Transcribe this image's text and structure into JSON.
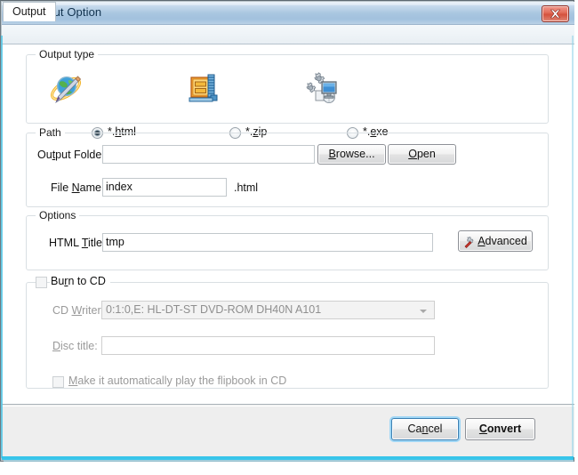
{
  "window": {
    "title": "Output Option",
    "app_icon": "question-mark-icon",
    "close_icon": "close-icon",
    "accent_border_color": "#27c0e8",
    "titlebar_color": "#a9c6e0"
  },
  "tabs": [
    {
      "label": "Output",
      "active": true
    }
  ],
  "output_type": {
    "legend": "Output type",
    "options": [
      {
        "icon": "globe-pencil-icon",
        "prefix": "*.",
        "pre": "h",
        "mnemonic": "h",
        "label_pre": "*.",
        "label_mn": "h",
        "label_post": "tml",
        "selected": true
      },
      {
        "icon": "zip-archive-icon",
        "label_pre": "*.",
        "label_mn": "z",
        "label_post": "ip",
        "selected": false
      },
      {
        "icon": "gears-monitor-icon",
        "label_pre": "*.",
        "label_mn": "e",
        "label_post": "xe",
        "selected": false
      }
    ]
  },
  "path": {
    "legend": "Path",
    "output_folder": {
      "label_pre": "Ou",
      "label_mn": "t",
      "label_post": "put Folder:",
      "value": "",
      "placeholder": ""
    },
    "browse_button": {
      "label_pre": "",
      "label_mn": "B",
      "label_post": "rowse..."
    },
    "open_button": {
      "label_pre": "",
      "label_mn": "O",
      "label_post": "pen"
    },
    "file_name": {
      "label_pre": "File ",
      "label_mn": "N",
      "label_post": "ame:",
      "value": "index",
      "extension": ".html"
    }
  },
  "options": {
    "legend": "Options",
    "html_title": {
      "label_pre": "HTML ",
      "label_mn": "T",
      "label_post": "itle:",
      "value": "tmp"
    },
    "advanced_button": {
      "icon": "gear-wrench-icon",
      "label_pre": "",
      "label_mn": "A",
      "label_post": "dvanced"
    }
  },
  "burn_to_cd": {
    "checkbox": {
      "label_pre": "Bu",
      "label_mn": "r",
      "label_post": "n to CD",
      "checked": false
    },
    "cd_writer": {
      "label_pre": "CD ",
      "label_mn": "W",
      "label_post": "riter",
      "value": "0:1:0,E: HL-DT-ST DVD-ROM DH40N   A101",
      "disabled": true
    },
    "disc_title": {
      "label_pre": "",
      "label_mn": "D",
      "label_post": "isc title:",
      "value": "",
      "disabled": true
    },
    "autoplay": {
      "label_pre": "",
      "label_mn": "M",
      "label_post": "ake it automatically play the flipbook in CD",
      "checked": false,
      "disabled": true
    }
  },
  "footer": {
    "cancel_button": {
      "label_pre": "Ca",
      "label_mn": "n",
      "label_post": "cel",
      "focused": true
    },
    "convert_button": {
      "label_pre": "",
      "label_mn": "C",
      "label_post": "onvert",
      "bold": true
    }
  }
}
